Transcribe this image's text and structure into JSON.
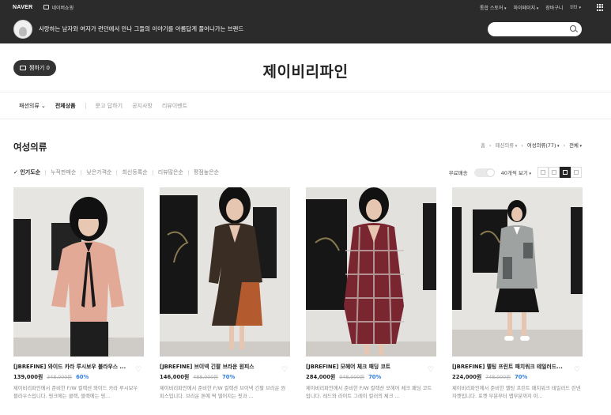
{
  "topbar": {
    "brand": "NAVER",
    "shopping": "네이버쇼핑",
    "links": [
      "통합 스토어",
      "마이페이지",
      "장바구니",
      "t!t!"
    ]
  },
  "banner": {
    "slogan": "사랑하는 남자와 여자가 런던에서 만나 그들의 이야기를 아름답게 풀어나가는 브랜드",
    "search_placeholder": ""
  },
  "store": {
    "wish_label": "찜하기 0",
    "name": "제이비리파인"
  },
  "nav": {
    "items": [
      "패션의류",
      "전체상품",
      "문고 답하기",
      "공지사항",
      "리뷰이벤트"
    ]
  },
  "section": {
    "title": "여성의류",
    "breadcrumb": [
      "홈",
      "패션의류",
      "여성의류(77)",
      "전체"
    ]
  },
  "sort": {
    "options": [
      "인기도순",
      "누적판매순",
      "낮은가격순",
      "최신등록순",
      "리뷰많은순",
      "평점높은순"
    ],
    "active": 0,
    "free_shipping_label": "무료배송",
    "per_page": "40개씩 보기"
  },
  "products": [
    {
      "name": "[JBREFINE] 와이드 카라 루시보우 블라우스 ...",
      "price": "139,000원",
      "original": "348,000원",
      "discount": "60%",
      "desc": "제이비리파인에서 준비한 F/W 컬렉션 와이드 카라 루시보우 블라우스입니다. 핑크에는 클랙, 블랙에는 핑..."
    },
    {
      "name": "[JBREFINE] 브이넥 긴팔 브라운 원피스",
      "price": "146,000원",
      "original": "488,000원",
      "discount": "70%",
      "desc": "제이비리파인에서 준비한 F/W 컬렉션 브이넥 긴팔 브라운 원피스입니다. 브라운 톤에 딱 떨어지는 핏과 ..."
    },
    {
      "name": "[JBREFINE] 모헤어 체크 패딩 코트",
      "price": "284,000원",
      "original": "948,000원",
      "discount": "70%",
      "desc": "제이비리파인에서 준비한 F/W 컬렉션 모헤어 체크 패딩 코트입니다. 레드와 라이트 그레이 컬러의 체크 ..."
    },
    {
      "name": "[JBREFINE] 멜팅 프린트 패치워크 테일러드...",
      "price": "224,000원",
      "original": "748,000원",
      "discount": "70%",
      "desc": "제이비리파인에서 준비한 멜팅 프린트 패치워크 테일러드 린넨 자켓입니다. 포켓 부분부터 앱부분까지 이..."
    }
  ]
}
